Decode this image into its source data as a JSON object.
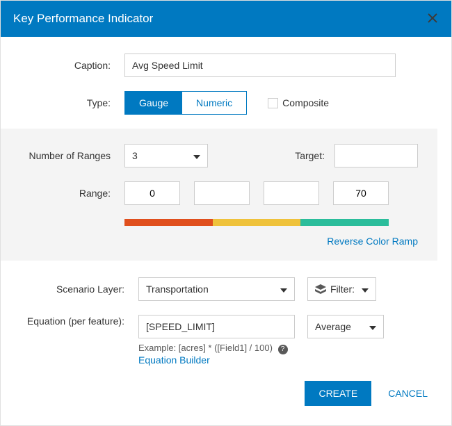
{
  "header": {
    "title": "Key Performance Indicator"
  },
  "caption": {
    "label": "Caption:",
    "value": "Avg Speed Limit"
  },
  "type": {
    "label": "Type:",
    "gauge": "Gauge",
    "numeric": "Numeric",
    "composite": "Composite"
  },
  "ranges": {
    "number_label": "Number of Ranges",
    "number_value": "3",
    "target_label": "Target:",
    "target_value": "",
    "range_label": "Range:",
    "values": [
      "0",
      "",
      "",
      "70"
    ],
    "reverse": "Reverse Color Ramp",
    "colors": [
      "#e04f1d",
      "#efc23b",
      "#2bbd9b"
    ]
  },
  "scenario": {
    "label": "Scenario Layer:",
    "value": "Transportation",
    "filter": "Filter:"
  },
  "equation": {
    "label": "Equation (per feature):",
    "value": "[SPEED_LIMIT]",
    "agg": "Average",
    "hint": "Example: [acres] * ([Field1] / 100)",
    "builder": "Equation Builder"
  },
  "footer": {
    "create": "CREATE",
    "cancel": "CANCEL"
  }
}
